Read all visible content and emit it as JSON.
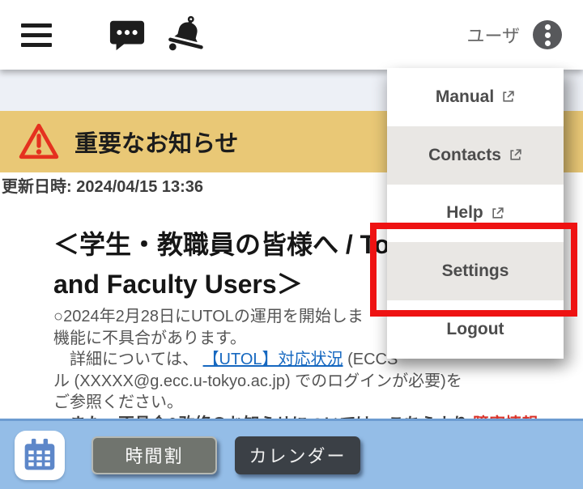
{
  "topbar": {
    "user_label": "ユーザ"
  },
  "menu": {
    "items": [
      {
        "label": "Manual"
      },
      {
        "label": "Contacts"
      },
      {
        "label": "Help"
      },
      {
        "label": "Settings"
      },
      {
        "label": "Logout"
      }
    ]
  },
  "banner": {
    "title": "重要なお知らせ"
  },
  "meta": {
    "updated": "更新日時: 2024/04/15 13:36"
  },
  "notice": {
    "heading_line1": "＜学生・教職員の皆様へ / To S",
    "heading_line2": "and Faculty Users＞",
    "para_line1": "○2024年2月28日にUTOLの運用を開始しま",
    "para_line2": "機能に不具合があります。",
    "detail_prefix": "　詳細については、 ",
    "detail_link": "【UTOL】対応状況",
    "detail_suffix": " (ECCS",
    "para_line4": "ル (XXXXX@g.ecc.u-tokyo.ac.jp) でのログインが必要)を",
    "para_line5": "ご参照ください。",
    "clipped_prefix": "　また、不具合&改修のお知らせについては、こちらより ",
    "clipped_link": "障害情報"
  },
  "footer": {
    "timetable": "時間割",
    "calendar": "カレンダー"
  },
  "colors": {
    "annotation_red": "#ee1212",
    "banner_yellow": "#e9c876",
    "warning_red": "#e5311f",
    "footer_blue": "#94bde7",
    "link_blue": "#1668c0"
  }
}
